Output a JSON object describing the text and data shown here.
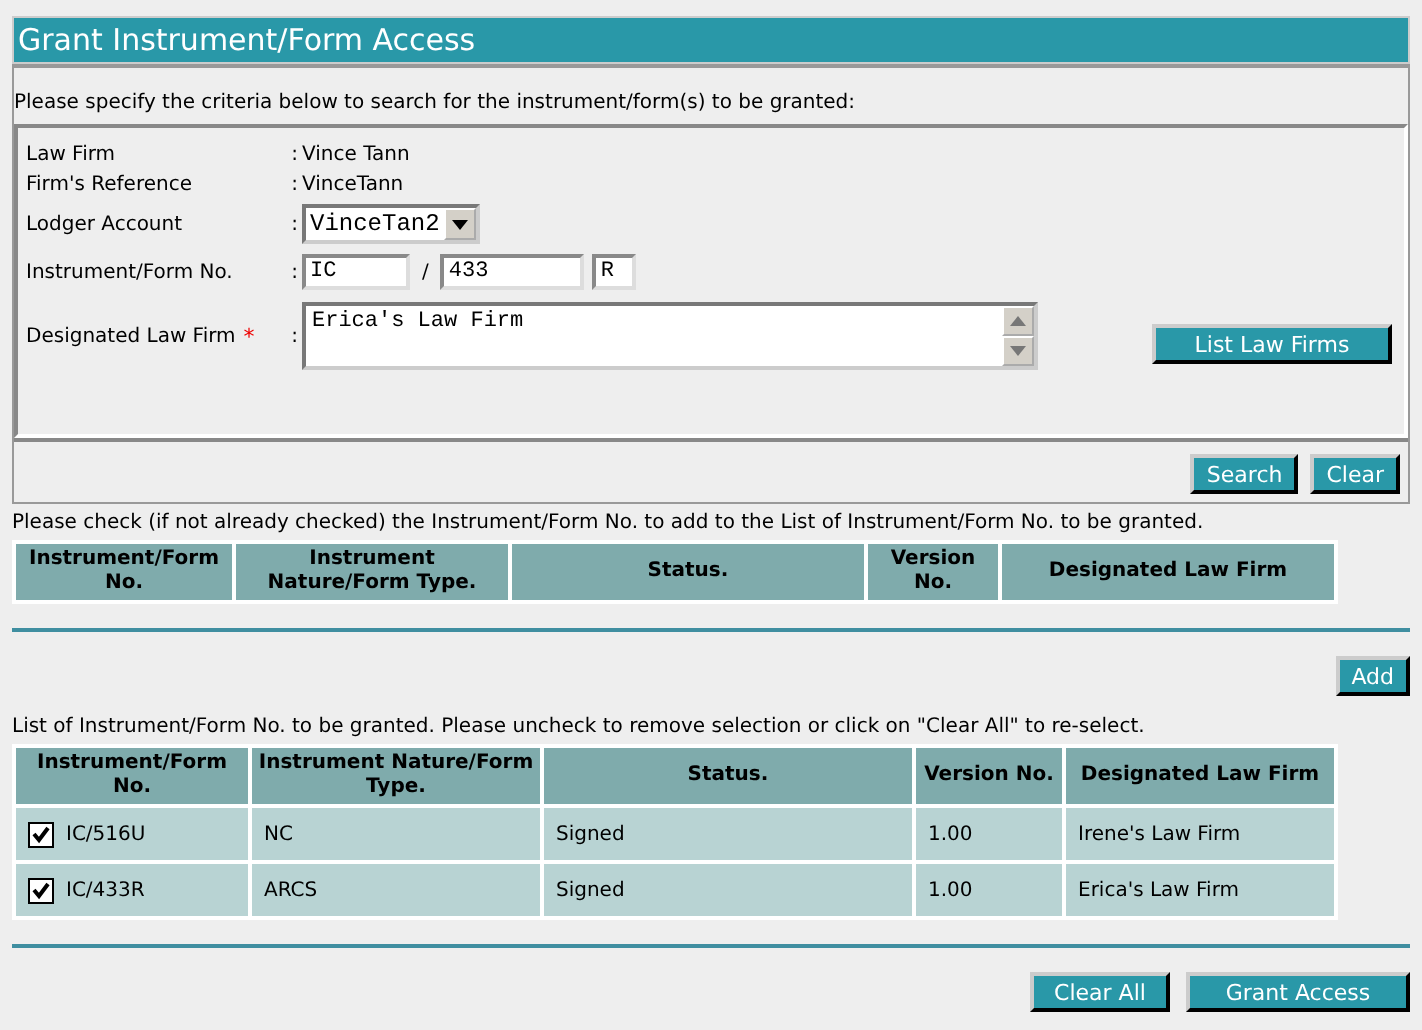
{
  "title": "Grant Instrument/Form Access",
  "criteria": {
    "intro": "Please specify the criteria below to search for the instrument/form(s) to be granted:",
    "fields": [
      {
        "kind": "text",
        "label": "Law Firm",
        "separator": ":",
        "value": "Vince Tann"
      },
      {
        "kind": "text",
        "label": "Firm's Reference",
        "separator": ":",
        "value": "VinceTann"
      },
      {
        "kind": "select",
        "label": "Lodger Account",
        "separator": ":",
        "value": "VinceTan2"
      },
      {
        "kind": "instrument",
        "label": "Instrument/Form No.",
        "separator": ":",
        "parts": [
          "IC",
          "433",
          "R"
        ],
        "joiner": "/"
      },
      {
        "kind": "textarea",
        "label": "Designated Law Firm",
        "required_mark": "*",
        "separator": ":",
        "value": "Erica's Law Firm"
      }
    ],
    "side_button": "List Law Firms",
    "buttons": [
      "Search",
      "Clear"
    ]
  },
  "results": {
    "intro": "Please check (if not already checked) the Instrument/Form No. to add to the List of Instrument/Form No. to be granted.",
    "columns": [
      "Instrument/Form No.",
      "Instrument Nature/Form Type.",
      "Status.",
      "Version No.",
      "Designated Law Firm"
    ],
    "add_button": "Add"
  },
  "granted": {
    "intro": "List of Instrument/Form No. to be granted. Please uncheck to remove selection or click on \"Clear All\" to re-select.",
    "columns": [
      "Instrument/Form No.",
      "Instrument Nature/Form Type.",
      "Status.",
      "Version No.",
      "Designated Law Firm"
    ],
    "rows": [
      {
        "checked": true,
        "cells": [
          "IC/516U",
          "NC",
          "Signed",
          "1.00",
          "Irene's Law Firm"
        ]
      },
      {
        "checked": true,
        "cells": [
          "IC/433R",
          "ARCS",
          "Signed",
          "1.00",
          "Erica's Law Firm"
        ]
      }
    ]
  },
  "buttons": [
    "Clear All",
    "Grant Access"
  ]
}
